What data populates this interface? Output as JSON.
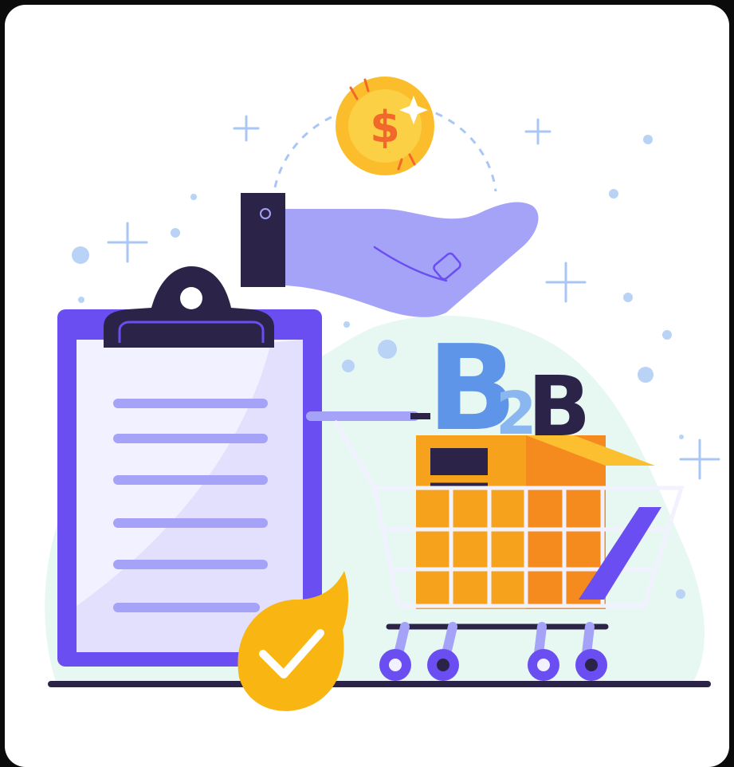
{
  "illustration": {
    "coin_symbol": "$",
    "badge_text": [
      "B",
      "2",
      "B"
    ],
    "colors": {
      "background": "#0b0b0c",
      "card": "#ffffff",
      "accent_purple": "#6a4ef2",
      "light_purple": "#a5a3f8",
      "navy": "#2b2448",
      "mint": "#e7f8f3",
      "sky_blue": "#5e95e8",
      "coin_yellow": "#fbbd2b",
      "coin_orange": "#f2672b",
      "box_orange": "#f7a21c",
      "check_yellow": "#f9b613"
    }
  }
}
